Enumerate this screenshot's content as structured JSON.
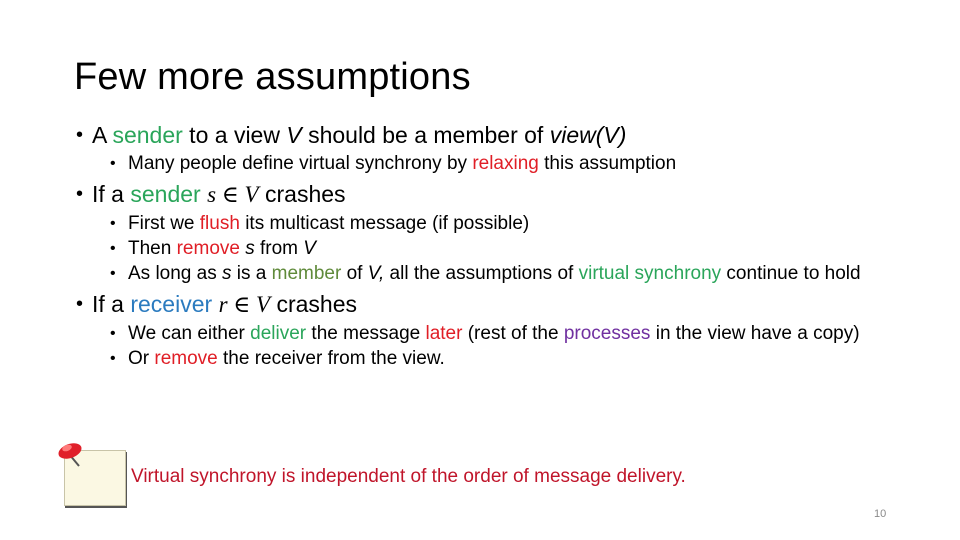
{
  "slide": {
    "title": "Few more assumptions",
    "page_number": "10",
    "bullets": [
      {
        "parts": [
          "A ",
          "sender",
          " to a view ",
          "V",
          " should be a member of ",
          "view(V)"
        ],
        "sub": [
          {
            "parts": [
              "Many people define virtual synchrony by ",
              "relaxing",
              " this assumption"
            ]
          }
        ]
      },
      {
        "parts": [
          "If a ",
          "sender",
          " ",
          "s ∈ V",
          " crashes"
        ],
        "sub": [
          {
            "parts": [
              "First we ",
              "flush",
              " its multicast message (if possible)"
            ]
          },
          {
            "parts": [
              "Then ",
              "remove",
              " ",
              "s",
              " from ",
              "V"
            ]
          },
          {
            "parts": [
              "As long as ",
              "s",
              " is a ",
              "member",
              " of ",
              "V,",
              " all the assumptions of ",
              "virtual synchrony",
              " continue to hold"
            ]
          }
        ]
      },
      {
        "parts": [
          "If a ",
          "receiver",
          " ",
          "r ∈ V",
          " crashes"
        ],
        "sub": [
          {
            "parts": [
              "We can either ",
              "deliver",
              " the message ",
              "later",
              " (rest of the ",
              "processes",
              " in the view have a copy)"
            ]
          },
          {
            "parts": [
              "Or ",
              "remove",
              " the receiver from the view."
            ]
          }
        ]
      }
    ],
    "note": {
      "icon": "pushpin-sticky-note-icon",
      "text": "Virtual synchrony is independent of the order of message delivery."
    },
    "colors": {
      "green": "#2aa55a",
      "olive": "#5f8a3a",
      "red": "#e01e26",
      "blue": "#2b7bbf",
      "purple": "#7030a0",
      "note_text": "#c0152a"
    }
  }
}
